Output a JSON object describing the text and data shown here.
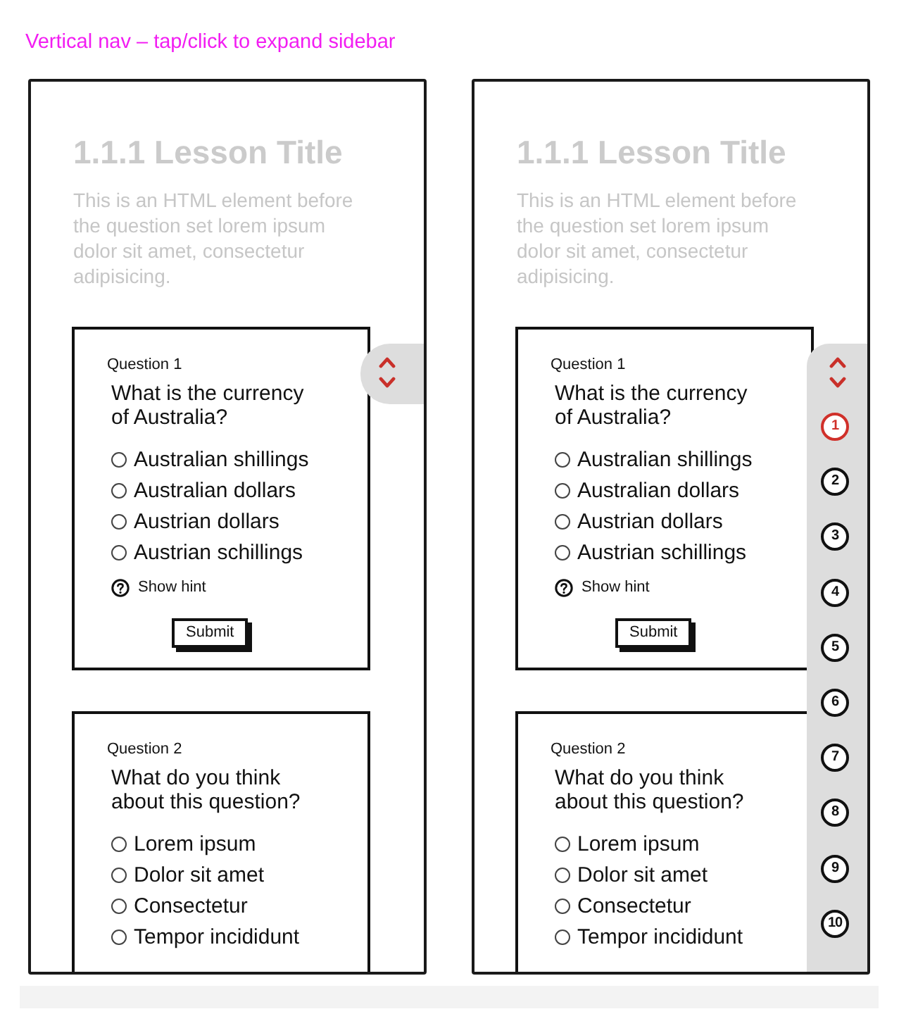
{
  "caption": "Vertical nav – tap/click to expand sidebar",
  "screens": [
    {
      "lesson": {
        "title": "1.1.1 Lesson Title",
        "intro": "This is an HTML element before the question set lorem ipsum dolor sit amet, consectetur adipisicing."
      },
      "questions": [
        {
          "label": "Question 1",
          "prompt": "What is the currency of Australia?",
          "options": [
            {
              "label": "Australian shillings",
              "selected": false
            },
            {
              "label": "Australian dollars",
              "selected": false
            },
            {
              "label": "Austrian dollars",
              "selected": false
            },
            {
              "label": "Austrian schillings",
              "selected": false
            }
          ],
          "hint": "Show hint",
          "submit": "Submit"
        },
        {
          "label": "Question 2",
          "prompt": "What do you think about this question?",
          "options": [
            {
              "label": "Lorem ipsum",
              "selected": false
            },
            {
              "label": "Dolor sit amet",
              "selected": false
            },
            {
              "label": "Consectetur",
              "selected": false
            },
            {
              "label": "Tempor incididunt",
              "selected": false
            }
          ]
        }
      ],
      "sidebar": {
        "expanded": false
      }
    },
    {
      "lesson": {
        "title": "1.1.1 Lesson Title",
        "intro": "This is an HTML element before the question set lorem ipsum dolor sit amet, consectetur adipisicing."
      },
      "questions": [
        {
          "label": "Question 1",
          "prompt": "What is the currency of Australia?",
          "options": [
            {
              "label": "Australian shillings",
              "selected": false
            },
            {
              "label": "Australian dollars",
              "selected": false
            },
            {
              "label": "Austrian dollars",
              "selected": false
            },
            {
              "label": "Austrian schillings",
              "selected": false
            }
          ],
          "hint": "Show hint",
          "submit": "Submit"
        },
        {
          "label": "Question 2",
          "prompt": "What do you think about this question?",
          "options": [
            {
              "label": "Lorem ipsum",
              "selected": false
            },
            {
              "label": "Dolor sit amet",
              "selected": false
            },
            {
              "label": "Consectetur",
              "selected": false
            },
            {
              "label": "Tempor incididunt",
              "selected": false
            }
          ]
        }
      ],
      "sidebar": {
        "expanded": true,
        "items": [
          {
            "label": "1",
            "selected": true
          },
          {
            "label": "2",
            "selected": false
          },
          {
            "label": "3",
            "selected": false
          },
          {
            "label": "4",
            "selected": false
          },
          {
            "label": "5",
            "selected": false
          },
          {
            "label": "6",
            "selected": false
          },
          {
            "label": "7",
            "selected": false
          },
          {
            "label": "8",
            "selected": false
          },
          {
            "label": "9",
            "selected": false
          },
          {
            "label": "10",
            "selected": false
          }
        ]
      }
    }
  ]
}
